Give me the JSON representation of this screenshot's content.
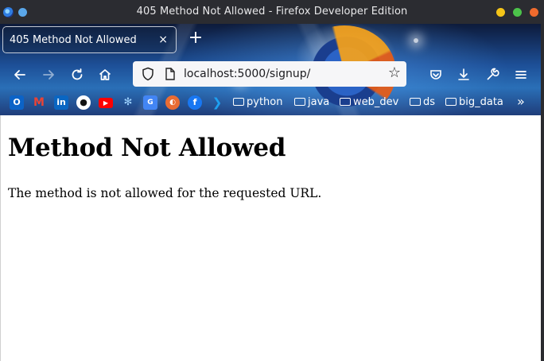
{
  "window": {
    "title": "405 Method Not Allowed - Firefox Developer Edition",
    "controls": [
      "minimize",
      "maximize",
      "close"
    ]
  },
  "tab": {
    "label": "405 Method Not Allowed",
    "close_glyph": "×",
    "new_tab_glyph": "+"
  },
  "toolbar": {
    "back_icon": "arrow-left",
    "forward_icon": "arrow-right",
    "reload_icon": "reload",
    "home_icon": "home",
    "url": "localhost:5000/signup/",
    "pocket_icon": "pocket",
    "download_icon": "download",
    "tools_icon": "wrench",
    "menu_icon": "hamburger"
  },
  "bookmarks": {
    "icons": [
      "outlook-icon",
      "gmail-icon",
      "linkedin-icon",
      "github-icon",
      "youtube-icon",
      "python-icon",
      "google-translate-icon",
      "unknown-icon",
      "facebook-icon",
      "twitter-icon"
    ],
    "folders": [
      {
        "label": "python"
      },
      {
        "label": "java"
      },
      {
        "label": "web_dev"
      },
      {
        "label": "ds"
      },
      {
        "label": "big_data"
      }
    ],
    "overflow_glyph": "»"
  },
  "page": {
    "heading": "Method Not Allowed",
    "message": "The method is not allowed for the requested URL."
  }
}
